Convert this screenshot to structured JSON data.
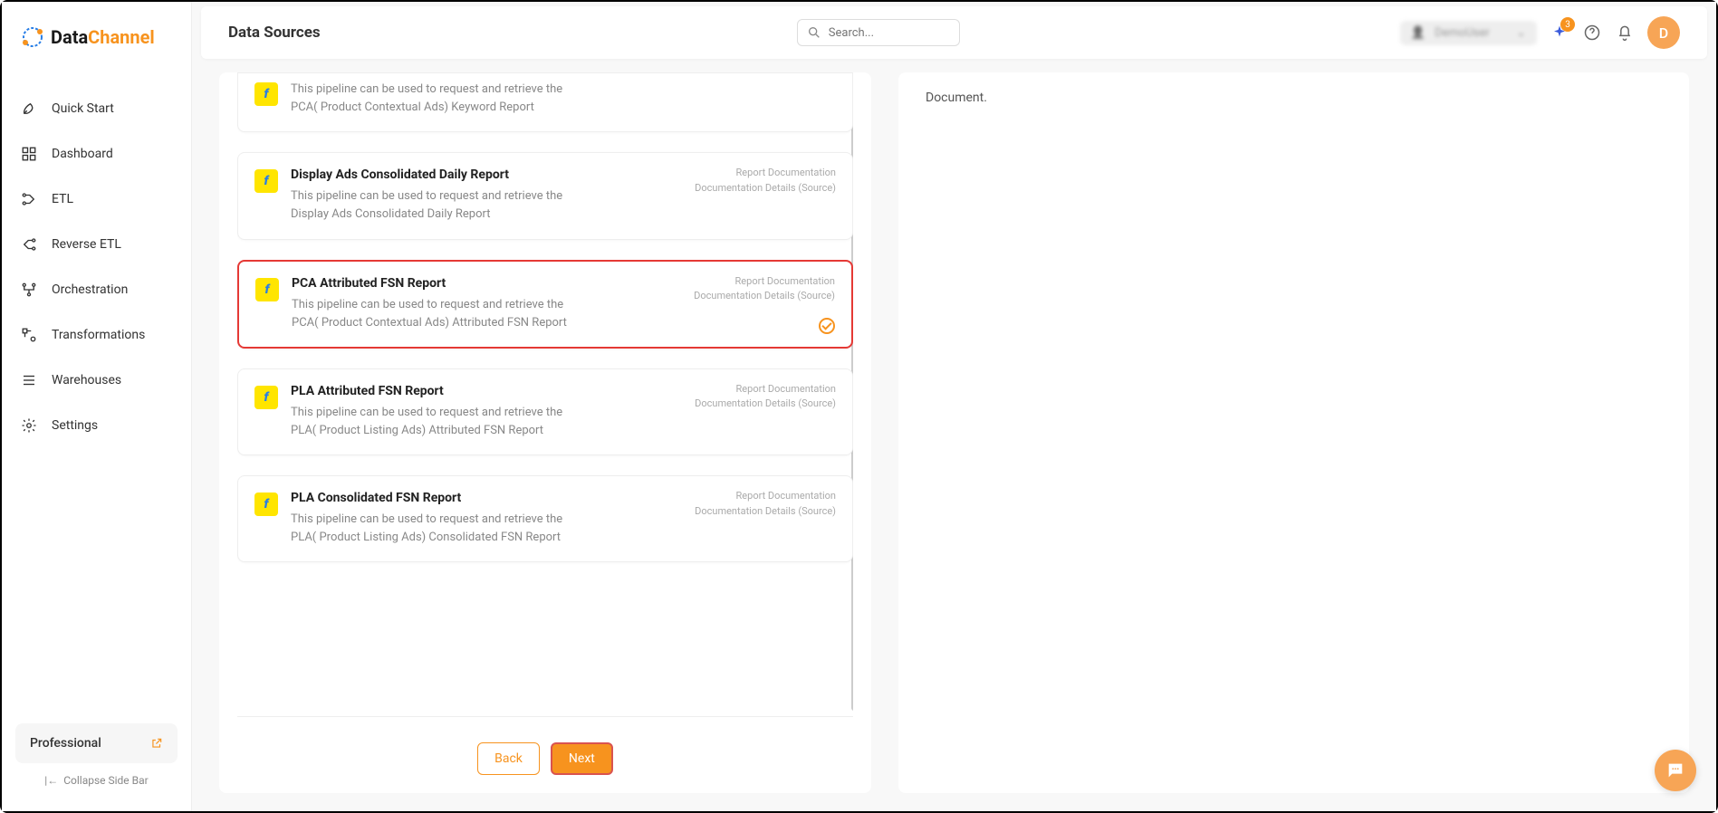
{
  "brand": {
    "name1": "Data",
    "name2": "Channel"
  },
  "sidebar": {
    "items": [
      {
        "label": "Quick Start"
      },
      {
        "label": "Dashboard"
      },
      {
        "label": "ETL"
      },
      {
        "label": "Reverse ETL"
      },
      {
        "label": "Orchestration"
      },
      {
        "label": "Transformations"
      },
      {
        "label": "Warehouses"
      },
      {
        "label": "Settings"
      }
    ],
    "plan": "Professional",
    "collapse": "Collapse Side Bar"
  },
  "header": {
    "title": "Data Sources",
    "search_placeholder": "Search...",
    "user": "DemoUser",
    "notif_count": "3",
    "avatar_initial": "D"
  },
  "side_panel": {
    "text": "Document."
  },
  "reports": [
    {
      "title": "",
      "desc": "This pipeline can be used to request and retrieve the PCA( Product Contextual Ads) Keyword Report",
      "doc1": "",
      "doc2": "",
      "partial": true,
      "selected": false
    },
    {
      "title": "Display Ads Consolidated Daily Report",
      "desc": "This pipeline can be used to request and retrieve the Display Ads Consolidated Daily Report",
      "doc1": "Report Documentation",
      "doc2": "Documentation Details (Source)",
      "partial": false,
      "selected": false
    },
    {
      "title": "PCA Attributed FSN Report",
      "desc": "This pipeline can be used to request and retrieve the PCA( Product Contextual Ads) Attributed FSN Report",
      "doc1": "Report Documentation",
      "doc2": "Documentation Details (Source)",
      "partial": false,
      "selected": true
    },
    {
      "title": "PLA Attributed FSN Report",
      "desc": "This pipeline can be used to request and retrieve the PLA( Product Listing Ads) Attributed FSN Report",
      "doc1": "Report Documentation",
      "doc2": "Documentation Details (Source)",
      "partial": false,
      "selected": false
    },
    {
      "title": "PLA Consolidated FSN Report",
      "desc": "This pipeline can be used to request and retrieve the PLA( Product Listing Ads) Consolidated FSN Report",
      "doc1": "Report Documentation",
      "doc2": "Documentation Details (Source)",
      "partial": false,
      "selected": false
    }
  ],
  "pager": {
    "back": "Back",
    "next": "Next"
  }
}
